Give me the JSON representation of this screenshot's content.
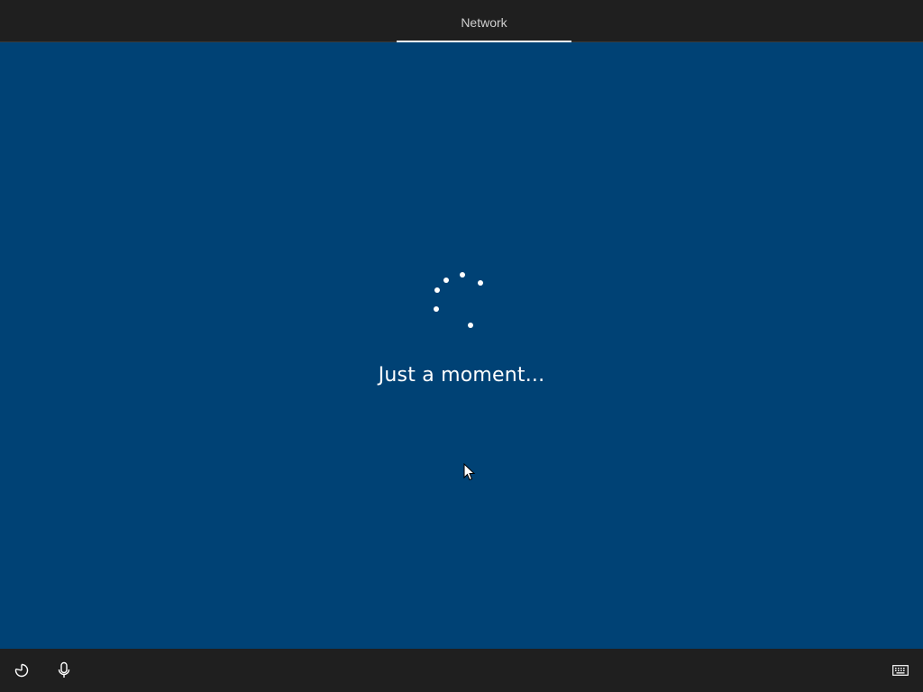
{
  "header": {
    "tabs": [
      {
        "label": "Network",
        "active": true
      }
    ]
  },
  "main": {
    "status_text": "Just a moment...",
    "spinner": "loading-dots"
  },
  "footer": {
    "left_icons": [
      "ease-of-access-icon",
      "microphone-icon"
    ],
    "right_icons": [
      "keyboard-icon"
    ]
  },
  "colors": {
    "background": "#004275",
    "bars": "#1f1f1f",
    "text": "#ffffff",
    "tab_text": "#cfcfcf"
  }
}
